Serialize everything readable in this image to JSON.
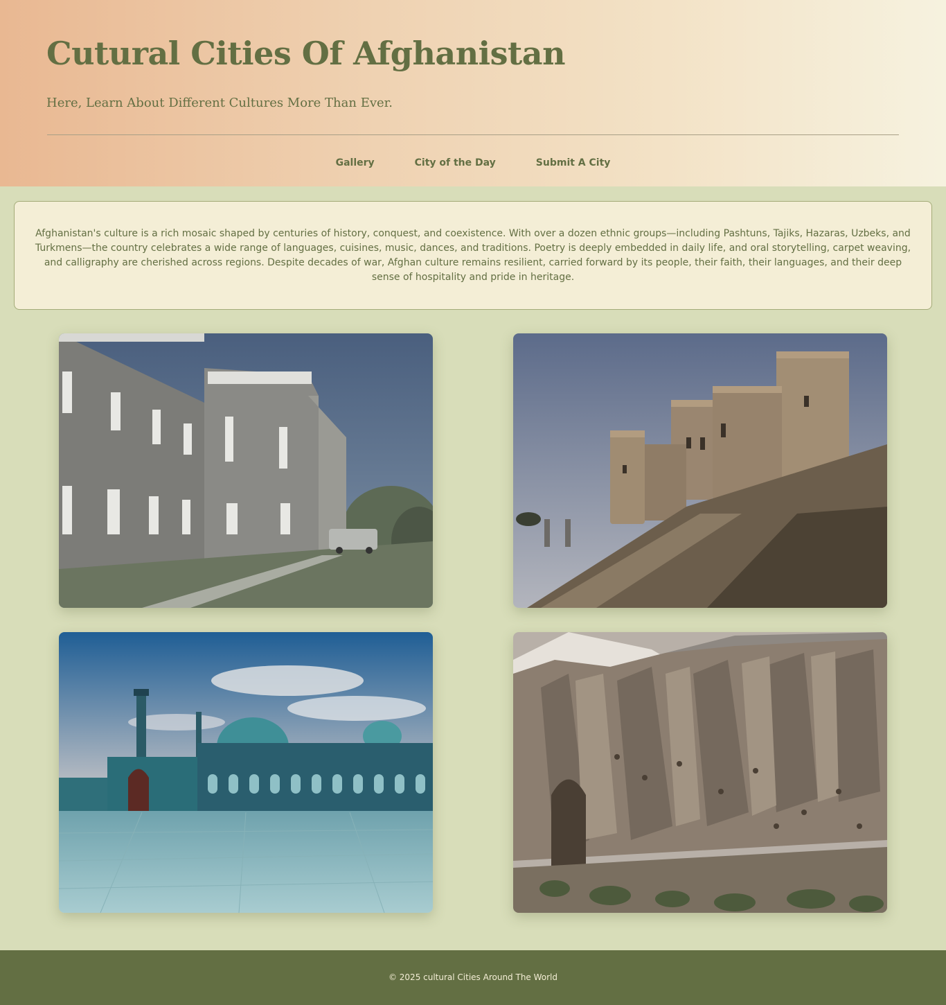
{
  "header": {
    "title": "Cutural Cities Of Afghanistan",
    "subtitle": "Here, Learn About Different Cultures More Than Ever."
  },
  "nav": {
    "items": [
      {
        "label": "Gallery"
      },
      {
        "label": "City of the Day"
      },
      {
        "label": "Submit A City"
      }
    ]
  },
  "intro": {
    "text": "Afghanistan's culture is a rich mosaic shaped by centuries of history, conquest, and coexistence. With over a dozen ethnic groups—including Pashtuns, Tajiks, Hazaras, Uzbeks, and Turkmens—the country celebrates a wide range of languages, cuisines, music, dances, and traditions. Poetry is deeply embedded in daily life, and oral storytelling, carpet weaving, and calligraphy are cherished across regions. Despite decades of war, Afghan culture remains resilient, carried forward by its people, their faith, their languages, and their deep sense of hospitality and pride in heritage."
  },
  "footer": {
    "text": "© 2025 cultural Cities Around The World"
  },
  "colors": {
    "accent": "#636f43",
    "page_background": "#d8ddb9",
    "card_background": "#f4eed6"
  }
}
